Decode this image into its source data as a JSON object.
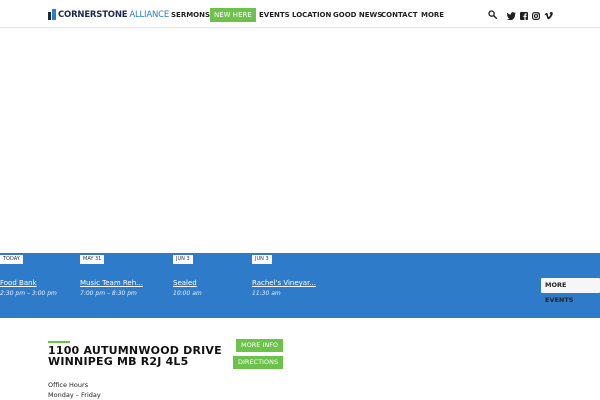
{
  "header": {
    "logo": {
      "primary": "CORNERSTONE",
      "secondary": "ALLIANCE"
    },
    "nav": [
      {
        "label": "SERMONS"
      },
      {
        "label": "NEW HERE",
        "highlight": "#6cc24a"
      },
      {
        "label": "EVENTS"
      },
      {
        "label": "LOCATION"
      },
      {
        "label": "GOOD NEWS"
      },
      {
        "label": "CONTACT"
      },
      {
        "label": "MORE"
      }
    ],
    "icons": [
      "search-icon",
      "twitter-icon",
      "facebook-icon",
      "instagram-icon",
      "vimeo-icon"
    ]
  },
  "events": {
    "items": [
      {
        "date": "TODAY",
        "title": "Food Bank",
        "time": "2:30 pm – 3:00 pm"
      },
      {
        "date": "MAY 31",
        "title": "Music Team Reh...",
        "time": "7:00 pm – 8:30 pm"
      },
      {
        "date": "JUN 3",
        "title": "Sealed",
        "time": "10:00 am"
      },
      {
        "date": "JUN 3",
        "title": "Rachel's Vineyar...",
        "time": "11:30 am"
      }
    ],
    "more_label": "MORE EVENTS"
  },
  "location": {
    "address_line1": "1100 AUTUMNWOOD DRIVE",
    "address_line2": "WINNIPEG MB R2J 4L5",
    "more_info_label": "MORE INFO",
    "directions_label": "DIRECTIONS",
    "office_hours_label": "Office Hours",
    "office_days": "Monday – Friday"
  },
  "colors": {
    "brand_dark": "#1c2a4a",
    "brand_blue": "#2e7cc9",
    "accent_green": "#6cc24a"
  }
}
